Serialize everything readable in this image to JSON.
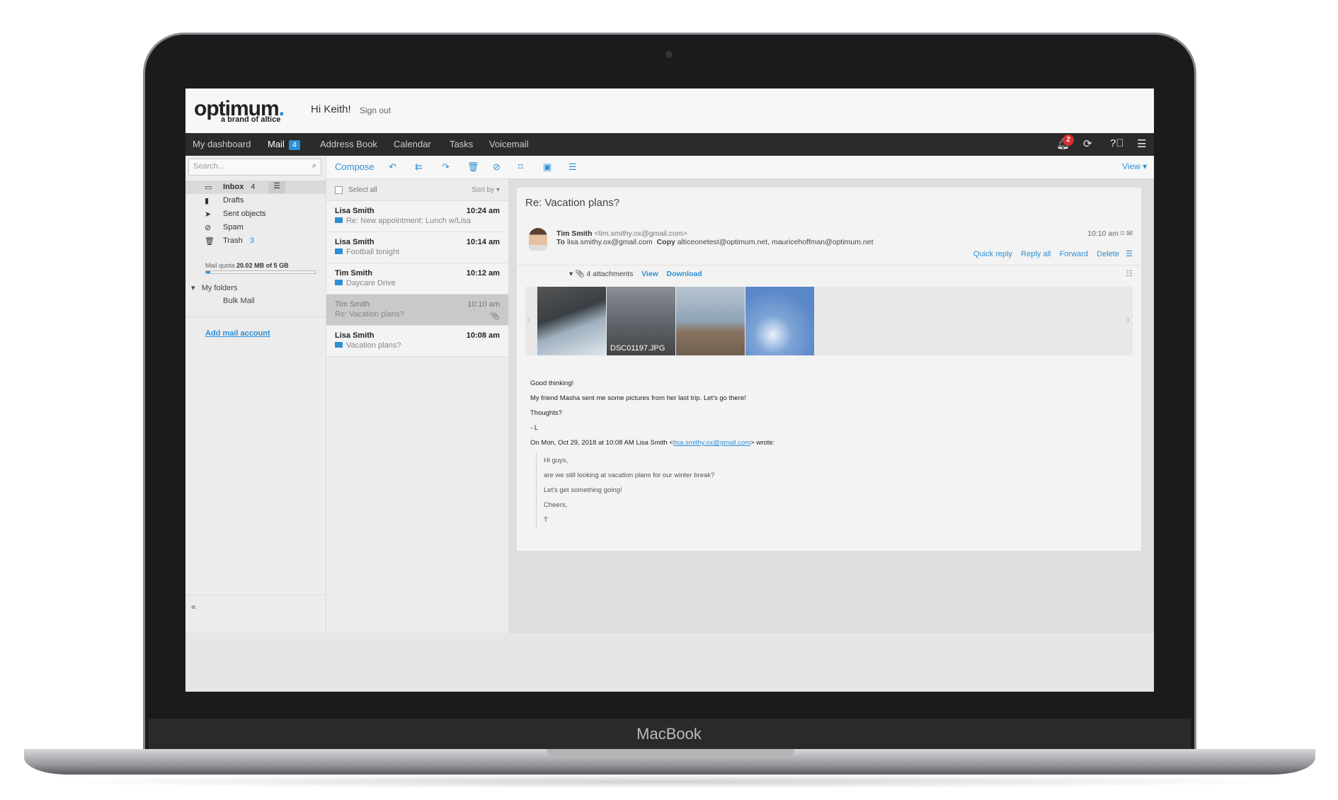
{
  "device": {
    "label": "MacBook"
  },
  "header": {
    "logo": "optimum",
    "logo_tagline": "a brand of altice",
    "greeting": "Hi Keith!",
    "sign_out": "Sign out"
  },
  "nav": {
    "items": [
      {
        "label": "My dashboard"
      },
      {
        "label": "Mail",
        "badge": "4"
      },
      {
        "label": "Address Book"
      },
      {
        "label": "Calendar"
      },
      {
        "label": "Tasks"
      },
      {
        "label": "Voicemail"
      }
    ],
    "notifications": "2"
  },
  "toolbar": {
    "compose": "Compose",
    "view": "View"
  },
  "sidebar": {
    "search_placeholder": "Search...",
    "folders": [
      {
        "label": "Inbox",
        "count": "4"
      },
      {
        "label": "Drafts"
      },
      {
        "label": "Sent objects"
      },
      {
        "label": "Spam"
      },
      {
        "label": "Trash",
        "count": "3"
      }
    ],
    "quota_label": "Mail quota",
    "quota_value": "20.02 MB of 5 GB",
    "quota_fraction": 0.004,
    "my_folders": "My folders",
    "subfolders": [
      "Bulk Mail"
    ],
    "add_account": "Add mail account",
    "collapse": "«"
  },
  "list": {
    "select_all": "Select all",
    "sort_by": "Sort by",
    "messages": [
      {
        "from": "Lisa Smith",
        "time": "10:24 am",
        "subject": "Re: New appointment: Lunch w/Lisa"
      },
      {
        "from": "Lisa Smith",
        "time": "10:14 am",
        "subject": "Football tonight"
      },
      {
        "from": "Tim Smith",
        "time": "10:12 am",
        "subject": "Daycare Drive"
      },
      {
        "from": "Tim Smith",
        "time": "10:10 am",
        "subject": "Re: Vacation plans?",
        "selected": true
      },
      {
        "from": "Lisa Smith",
        "time": "10:08 am",
        "subject": "Vacation plans?"
      }
    ]
  },
  "message": {
    "subject": "Re: Vacation plans?",
    "from_name": "Tim Smith",
    "from_email": "<tim.smithy.ox@gmail.com>",
    "to_label": "To",
    "to": "lisa.smithy.ox@gmail.com",
    "copy_label": "Copy",
    "cc": "alticeonetest@optimum.net,   mauricehoffman@optimum.net",
    "time": "10:10 am",
    "actions": [
      "Quick reply",
      "Reply all",
      "Forward",
      "Delete"
    ],
    "attachments": {
      "count_label": "4 attachments",
      "view": "View",
      "download": "Download",
      "caption": "DSC01197.JPG"
    },
    "body": [
      "Good thinking!",
      "My friend Masha sent me some pictures from her last trip. Let's go there!",
      "Thoughts?",
      "- L"
    ],
    "quote_header_pre": "On Mon, Oct 29, 2018 at 10:08 AM Lisa Smith <",
    "quote_email": "lisa.smithy.ox@gmail.com",
    "quote_header_post": "> wrote:",
    "quote": [
      "Hi guys,",
      "are we still looking at vacation plans for our winter break?",
      "Let's get something going!",
      "Cheers,",
      "T"
    ]
  }
}
